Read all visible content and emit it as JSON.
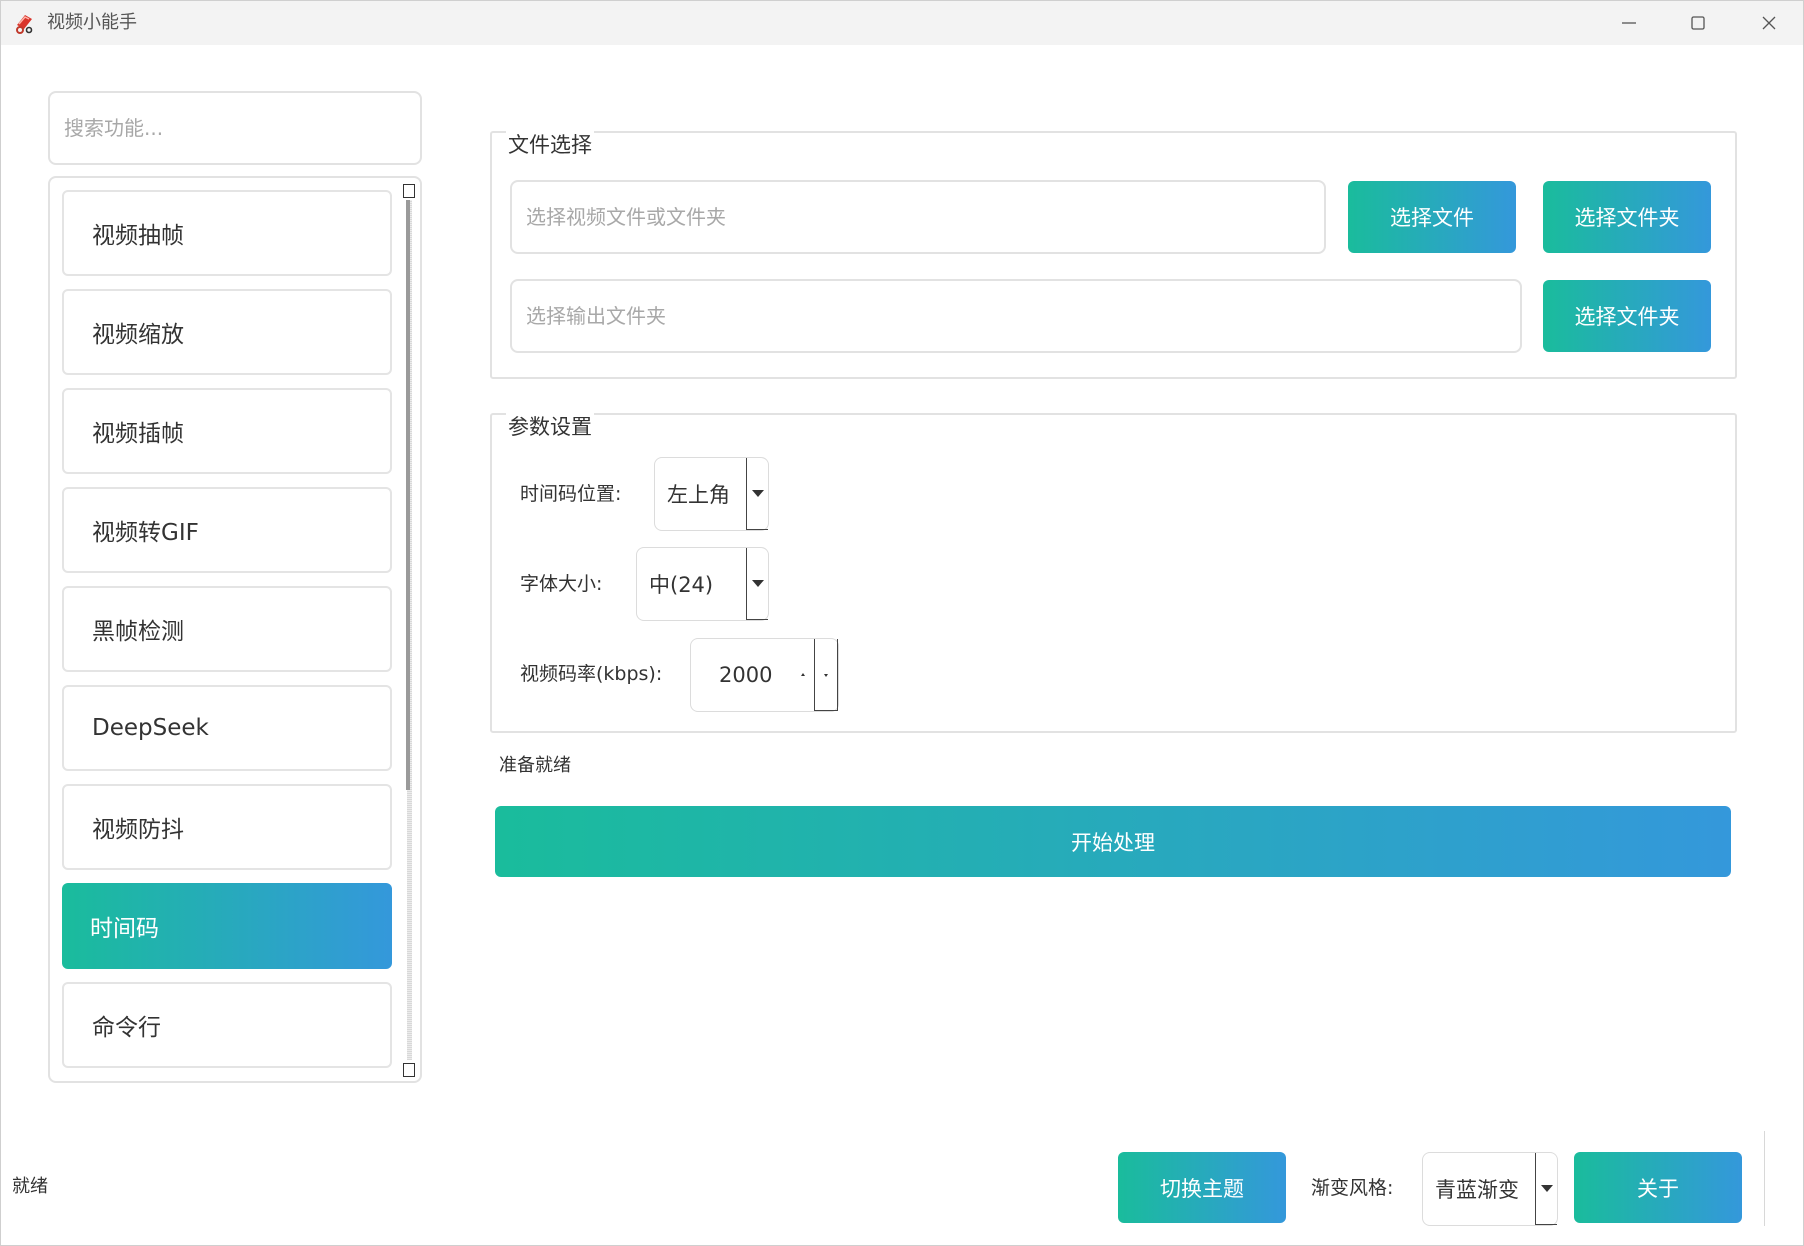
{
  "window": {
    "title": "视频小能手",
    "accent_gradient": [
      "#1abc9c",
      "#3498db"
    ],
    "icon": "app-tools-icon"
  },
  "sidebar": {
    "search_placeholder": "搜索功能...",
    "items": [
      {
        "label": "视频抽帧",
        "active": false
      },
      {
        "label": "视频缩放",
        "active": false
      },
      {
        "label": "视频插帧",
        "active": false
      },
      {
        "label": "视频转GIF",
        "active": false
      },
      {
        "label": "黑帧检测",
        "active": false
      },
      {
        "label": "DeepSeek",
        "active": false
      },
      {
        "label": "视频防抖",
        "active": false
      },
      {
        "label": "时间码",
        "active": true
      },
      {
        "label": "命令行",
        "active": false
      }
    ]
  },
  "file_group": {
    "title": "文件选择",
    "input_placeholder": "选择视频文件或文件夹",
    "output_placeholder": "选择输出文件夹",
    "select_file_label": "选择文件",
    "select_folder_label": "选择文件夹",
    "select_output_folder_label": "选择文件夹"
  },
  "param_group": {
    "title": "参数设置",
    "timecode_position_label": "时间码位置:",
    "timecode_position_value": "左上角",
    "font_size_label": "字体大小:",
    "font_size_value": "中(24)",
    "bitrate_label": "视频码率(kbps):",
    "bitrate_value": "2000"
  },
  "status": {
    "ready_text": "准备就绪",
    "start_label": "开始处理"
  },
  "footer": {
    "status": "就绪",
    "switch_theme_label": "切换主题",
    "gradient_style_label": "渐变风格:",
    "gradient_style_value": "青蓝渐变",
    "about_label": "关于"
  }
}
